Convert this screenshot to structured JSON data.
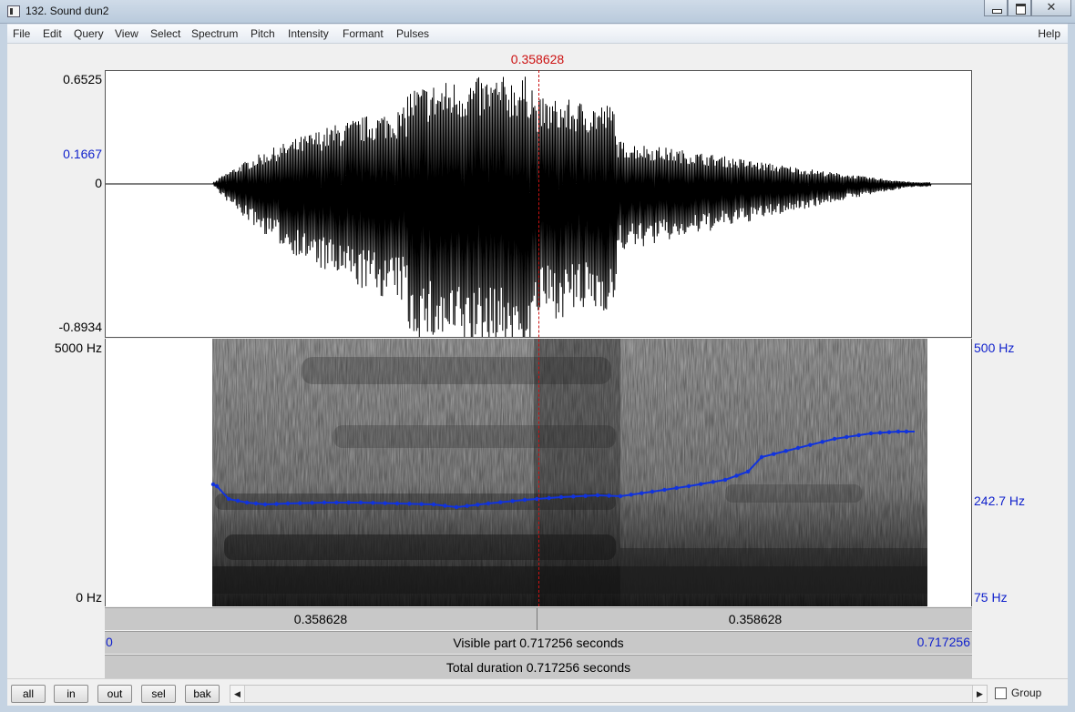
{
  "window": {
    "title": "132. Sound dun2",
    "minimize_icon": "minimize-icon",
    "maximize_icon": "maximize-icon",
    "close_icon": "close-icon",
    "close_glyph": "✕"
  },
  "menu": {
    "items": [
      "File",
      "Edit",
      "Query",
      "View",
      "Select",
      "Spectrum",
      "Pitch",
      "Intensity",
      "Formant",
      "Pulses"
    ],
    "help": "Help"
  },
  "cursor": {
    "time_label": "0.358628",
    "time": 0.358628
  },
  "waveform": {
    "y_max": "0.6525",
    "y_cursor": "0.1667",
    "y_zero": "0",
    "y_min": "-0.8934"
  },
  "spectrogram": {
    "freq_max": "5000 Hz",
    "freq_min": "0 Hz",
    "pitch_max": "500 Hz",
    "pitch_cursor": "242.7 Hz",
    "pitch_min": "75 Hz"
  },
  "time_axis": {
    "left_segment": "0.358628",
    "right_segment": "0.358628",
    "start": "0",
    "end": "0.717256",
    "visible_part": "Visible part 0.717256 seconds",
    "total_duration": "Total duration 0.717256 seconds"
  },
  "buttons": {
    "all": "all",
    "in": "in",
    "out": "out",
    "sel": "sel",
    "bak": "bak"
  },
  "scrollbar": {
    "left_arrow": "◀",
    "right_arrow": "▶"
  },
  "group": {
    "label": "Group",
    "checked": false
  },
  "colors": {
    "cursor": "#cc1111",
    "pitch": "#1122cc",
    "wave": "#000000"
  }
}
